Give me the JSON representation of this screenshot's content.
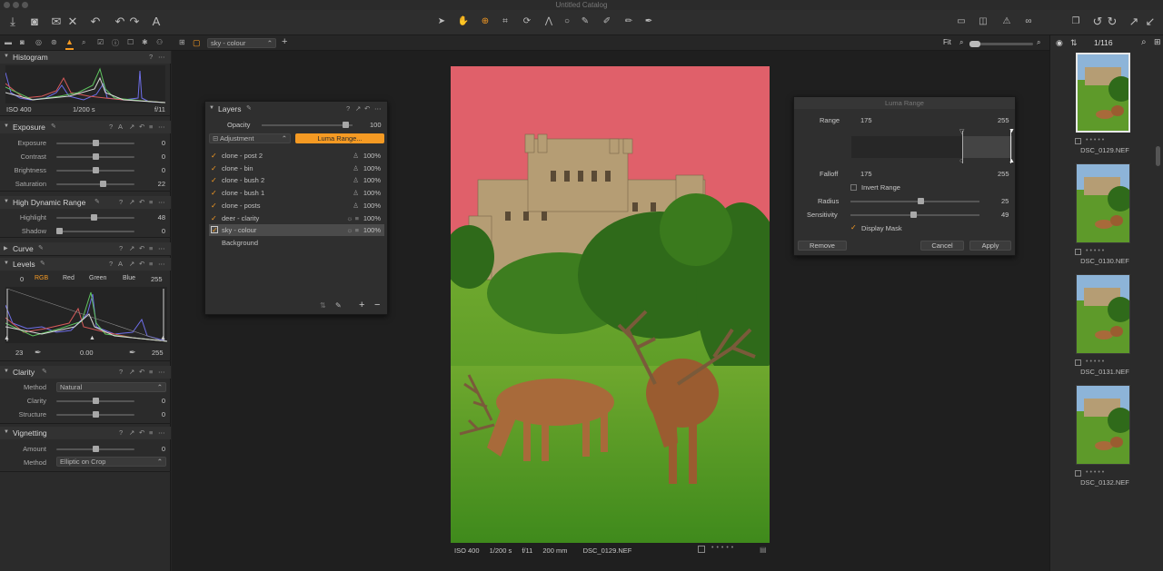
{
  "window": {
    "title": "Untitled Catalog"
  },
  "toolrow": {
    "style_name": "sky - colour",
    "fit_label": "Fit",
    "counter": "1/116"
  },
  "histogram": {
    "title": "Histogram",
    "iso": "ISO 400",
    "shutter": "1/200 s",
    "aperture": "f/11"
  },
  "exposure": {
    "title": "Exposure",
    "rows": [
      {
        "label": "Exposure",
        "value": "0",
        "pos": 0.5
      },
      {
        "label": "Contrast",
        "value": "0",
        "pos": 0.5
      },
      {
        "label": "Brightness",
        "value": "0",
        "pos": 0.5
      },
      {
        "label": "Saturation",
        "value": "22",
        "pos": 0.61
      }
    ]
  },
  "hdr": {
    "title": "High Dynamic Range",
    "rows": [
      {
        "label": "Highlight",
        "value": "48",
        "pos": 0.48
      },
      {
        "label": "Shadow",
        "value": "0",
        "pos": 0.0
      }
    ]
  },
  "curve": {
    "title": "Curve"
  },
  "levels": {
    "title": "Levels",
    "low": "0",
    "high": "255",
    "tabs": [
      "RGB",
      "Red",
      "Green",
      "Blue"
    ],
    "out_low": "23",
    "mid": "0.00",
    "out_high": "255"
  },
  "clarity": {
    "title": "Clarity",
    "method_label": "Method",
    "method_value": "Natural",
    "rows": [
      {
        "label": "Clarity",
        "value": "0",
        "pos": 0.5
      },
      {
        "label": "Structure",
        "value": "0",
        "pos": 0.5
      }
    ]
  },
  "vignetting": {
    "title": "Vignetting",
    "amount_label": "Amount",
    "amount_value": "0",
    "amount_pos": 0.5,
    "method_label": "Method",
    "method_value": "Elliptic on Crop"
  },
  "layers": {
    "title": "Layers",
    "opacity_label": "Opacity",
    "opacity_value": "100",
    "opacity_pos": 1.0,
    "adjustment_label": "Adjustment",
    "luma_button": "Luma Range...",
    "items": [
      {
        "name": "clone - post 2",
        "pct": "100%",
        "checked": true,
        "selected": false,
        "kind": "stamp"
      },
      {
        "name": "clone - bin",
        "pct": "100%",
        "checked": true,
        "selected": false,
        "kind": "stamp"
      },
      {
        "name": "clone - bush 2",
        "pct": "100%",
        "checked": true,
        "selected": false,
        "kind": "stamp"
      },
      {
        "name": "clone - bush 1",
        "pct": "100%",
        "checked": true,
        "selected": false,
        "kind": "stamp"
      },
      {
        "name": "clone - posts",
        "pct": "100%",
        "checked": true,
        "selected": false,
        "kind": "stamp"
      },
      {
        "name": "deer - clarity",
        "pct": "100%",
        "checked": true,
        "selected": false,
        "kind": "adjust"
      },
      {
        "name": "sky - colour",
        "pct": "100%",
        "checked": true,
        "selected": true,
        "kind": "adjust"
      },
      {
        "name": "Background",
        "pct": "",
        "checked": false,
        "selected": false,
        "kind": "none"
      }
    ]
  },
  "luma": {
    "title": "Luma Range",
    "range_label": "Range",
    "range_low": "175",
    "range_high": "255",
    "falloff_label": "Falloff",
    "falloff_low": "175",
    "falloff_high": "255",
    "invert_label": "Invert Range",
    "radius_label": "Radius",
    "radius_value": "25",
    "radius_pos": 0.55,
    "sensitivity_label": "Sensitivity",
    "sensitivity_value": "49",
    "sensitivity_pos": 0.49,
    "display_mask_label": "Display Mask",
    "remove_label": "Remove",
    "cancel_label": "Cancel",
    "apply_label": "Apply"
  },
  "status": {
    "iso": "ISO 400",
    "shutter": "1/200 s",
    "aperture": "f/11",
    "focal": "200 mm",
    "file": "DSC_0129.NEF"
  },
  "browser": {
    "files": [
      "DSC_0129.NEF",
      "DSC_0130.NEF",
      "DSC_0131.NEF",
      "DSC_0132.NEF"
    ]
  },
  "colors": {
    "accent": "#f59a23",
    "mask": "#e0606a",
    "panel": "#2b2b2b"
  }
}
